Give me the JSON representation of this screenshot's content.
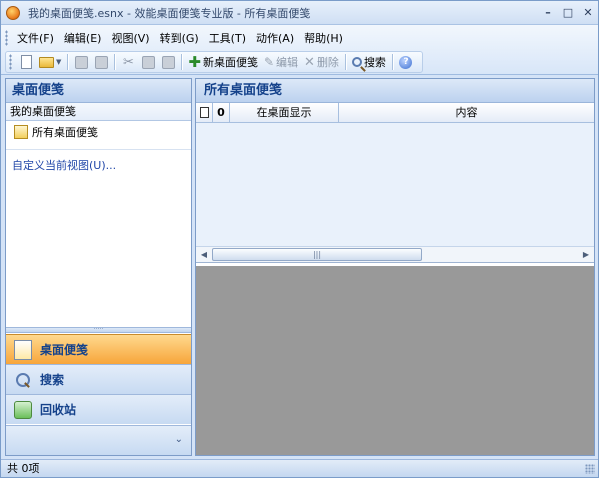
{
  "window": {
    "title": "我的桌面便笺.esnx - 效能桌面便笺专业版 - 所有桌面便笺",
    "min": "–",
    "max": "□",
    "close": "✕"
  },
  "menu": [
    "文件(F)",
    "编辑(E)",
    "视图(V)",
    "转到(G)",
    "工具(T)",
    "动作(A)",
    "帮助(H)"
  ],
  "toolbar": {
    "new_note": "新桌面便笺",
    "edit": "编辑",
    "delete": "删除",
    "search": "搜索"
  },
  "nav": {
    "header": "桌面便笺",
    "group_title": "我的桌面便笺",
    "folder": "所有桌面便笺",
    "customize_link": "自定义当前视图(U)...",
    "splitter": "·····",
    "buttons": {
      "notes": "桌面便笺",
      "search": "搜索",
      "recycle": "回收站"
    },
    "footer_chevron": "⌄"
  },
  "content": {
    "header": "所有桌面便笺",
    "columns": {
      "clip": "0",
      "desktop": "在桌面显示",
      "content": "内容"
    },
    "scroll_thumb": "|||",
    "scroll_left": "◀",
    "scroll_right": "▶"
  },
  "status": {
    "text": "共 0项"
  },
  "colors": {
    "accent_active": "#f7a53a",
    "header_text": "#15428b",
    "reading_pane": "#999999"
  }
}
